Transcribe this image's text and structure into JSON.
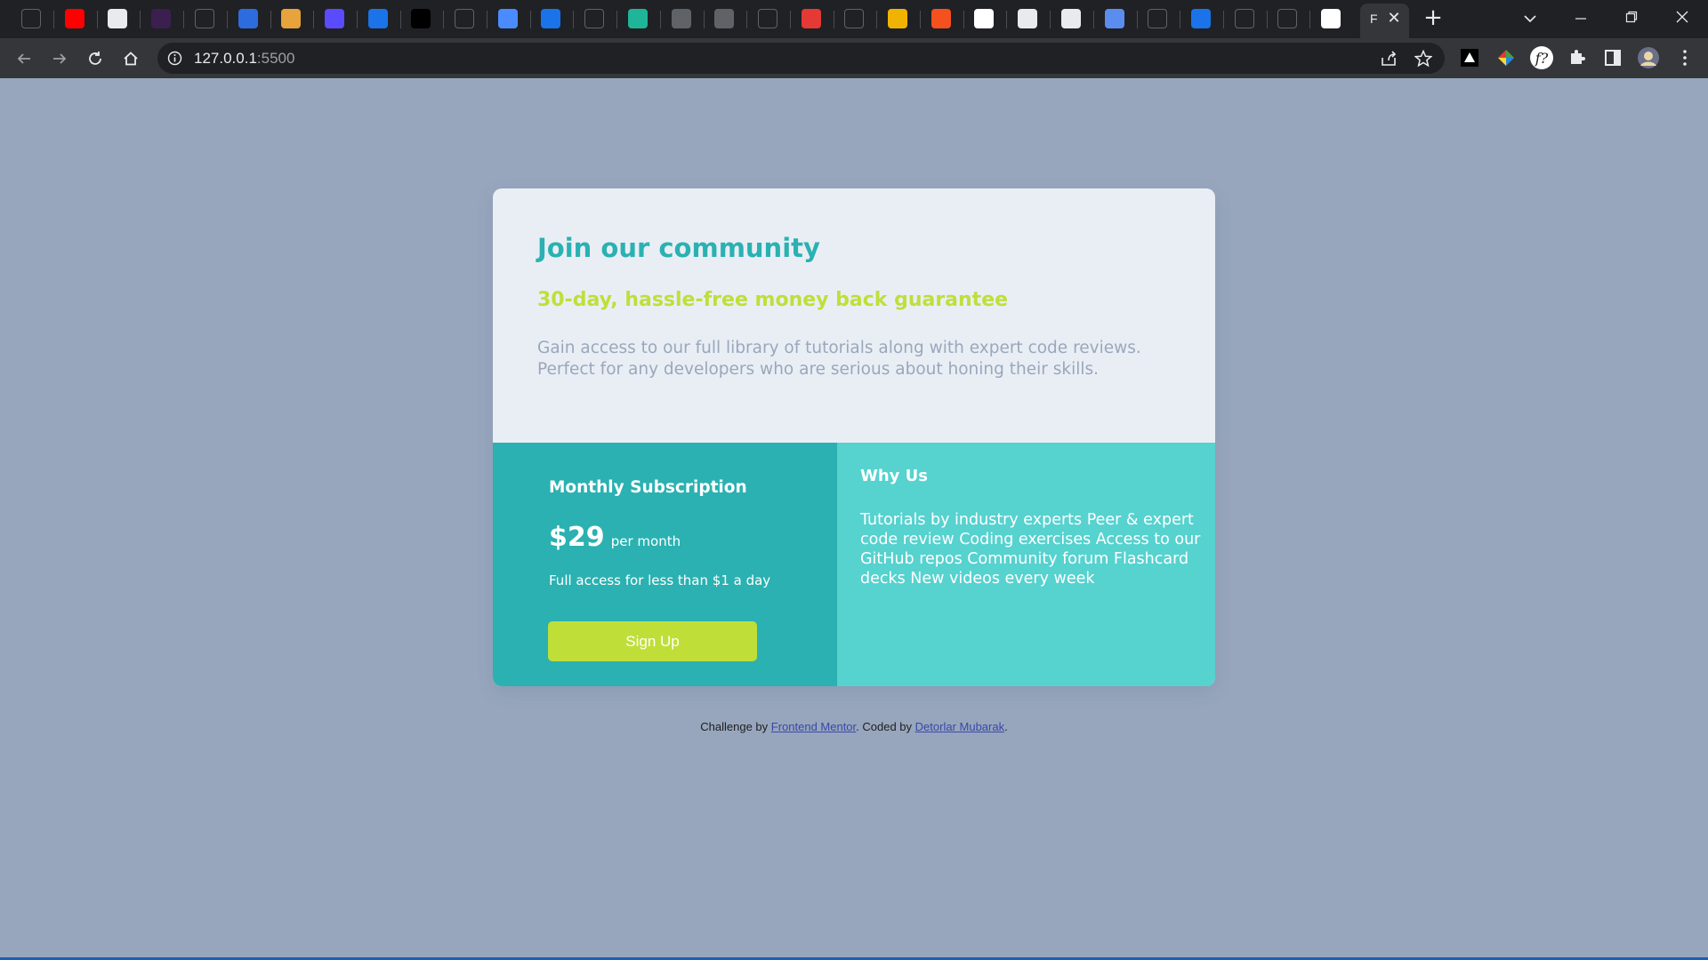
{
  "browser": {
    "active_tab_label": "F",
    "url_host": "127.0.0.1",
    "url_port": ":5500",
    "tab_favicons": [
      {
        "name": "github-icon",
        "color": "#202124",
        "glyph": ""
      },
      {
        "name": "youtube-icon",
        "color": "#ff0000",
        "glyph": ""
      },
      {
        "name": "page-icon",
        "color": "#e8eaed",
        "glyph": ""
      },
      {
        "name": "slack-like-icon",
        "color": "#3b1f4f",
        "glyph": ""
      },
      {
        "name": "regex-icon",
        "color": "#202124",
        "glyph": ""
      },
      {
        "name": "shield-icon",
        "color": "#2d6cdf",
        "glyph": ""
      },
      {
        "name": "cat-icon",
        "color": "#e8a33d",
        "glyph": ""
      },
      {
        "name": "s-icon",
        "color": "#5b4bff",
        "glyph": ""
      },
      {
        "name": "q-icon",
        "color": "#1a73e8",
        "glyph": ""
      },
      {
        "name": "triangle-icon",
        "color": "#000000",
        "glyph": ""
      },
      {
        "name": "code-icon",
        "color": "#202124",
        "glyph": ""
      },
      {
        "name": "flag-icon",
        "color": "#4a8cff",
        "glyph": ""
      },
      {
        "name": "q-icon",
        "color": "#1a73e8",
        "glyph": ""
      },
      {
        "name": "brackets-icon",
        "color": "#202124",
        "glyph": ""
      },
      {
        "name": "diamond-icon",
        "color": "#1fb598",
        "glyph": ""
      },
      {
        "name": "globe-icon",
        "color": "#5f6368",
        "glyph": ""
      },
      {
        "name": "globe-icon",
        "color": "#5f6368",
        "glyph": ""
      },
      {
        "name": "dev-icon",
        "color": "#202124",
        "glyph": ""
      },
      {
        "name": "red-square-icon",
        "color": "#e53935",
        "glyph": ""
      },
      {
        "name": "m-icon",
        "color": "#202124",
        "glyph": ""
      },
      {
        "name": "js-icon",
        "color": "#f0b400",
        "glyph": ""
      },
      {
        "name": "code-red-icon",
        "color": "#f4511e",
        "glyph": ""
      },
      {
        "name": "codepen-icon",
        "color": "#ffffff",
        "glyph": ""
      },
      {
        "name": "search-icon",
        "color": "#e8eaed",
        "glyph": ""
      },
      {
        "name": "doc-icon",
        "color": "#e8eaed",
        "glyph": ""
      },
      {
        "name": "rebo-icon",
        "color": "#5b8def",
        "glyph": ""
      },
      {
        "name": "m-dark-icon",
        "color": "#202124",
        "glyph": ""
      },
      {
        "name": "i-icon",
        "color": "#1a73e8",
        "glyph": ""
      },
      {
        "name": "w-icon",
        "color": "#202124",
        "glyph": ""
      },
      {
        "name": "ms-icon",
        "color": "#202124",
        "glyph": ""
      },
      {
        "name": "frontend-mentor-icon",
        "color": "#ffffff",
        "glyph": ""
      }
    ]
  },
  "card": {
    "title": "Join our community",
    "subtitle": "30-day, hassle-free money back guarantee",
    "description": "Gain access to our full library of tutorials along with expert code reviews. Perfect for any developers who are serious about honing their skills."
  },
  "subscription": {
    "heading": "Monthly Subscription",
    "price": "$29",
    "period": "per month",
    "note": "Full access for less than $1 a day",
    "button_label": "Sign Up"
  },
  "why_us": {
    "heading": "Why Us",
    "text": "Tutorials by industry experts Peer & expert code review Coding exercises Access to our GitHub repos Community forum Flashcard decks New videos every week"
  },
  "footer": {
    "prefix": "Challenge by ",
    "link1": "Frontend Mentor",
    "middle": ". Coded by ",
    "link2": "Detorlar Mubarak",
    "suffix": "."
  },
  "colors": {
    "page_bg": "#97a6bd",
    "accent_teal": "#2bb1b1",
    "light_teal": "#56d2cf",
    "lime": "#bfdf38",
    "card_bg": "#e9eef5",
    "muted_text": "#9aa7bb"
  }
}
